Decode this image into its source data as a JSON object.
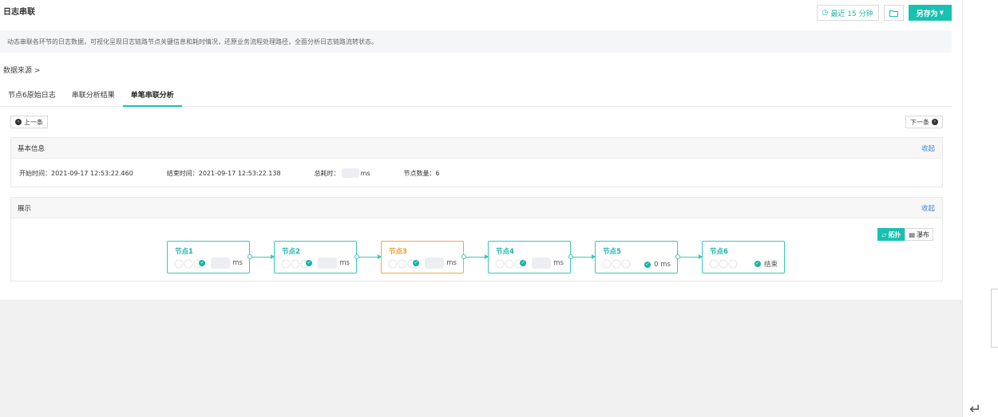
{
  "header": {
    "title": "日志串联",
    "time_range": "最近 15 分钟",
    "save_as": "另存为"
  },
  "description": "动态串联各环节的日志数据，可视化呈现日志链路节点关键信息和耗时情况，还原业务流程处理路径，全面分析日志链路流转状态。",
  "data_source": "数据来源 >",
  "tabs": [
    {
      "label": "节点6原始日志"
    },
    {
      "label": "串联分析结果"
    },
    {
      "label": "单笔串联分析"
    }
  ],
  "nav": {
    "prev": "上一条",
    "next": "下一条"
  },
  "basic_info": {
    "title": "基本信息",
    "collapse": "收起",
    "start_label": "开始时间：",
    "start_value": "2021-09-17 12:53:22.460",
    "end_label": "结束时间：",
    "end_value": "2021-09-17 12:53:22.138",
    "total_label": "总耗时：",
    "total_unit": "ms",
    "count_label": "节点数量：",
    "count_value": "6"
  },
  "display": {
    "title": "展示",
    "collapse": "收起",
    "view_topology": "拓扑",
    "view_waterfall": "瀑布",
    "nodes": [
      {
        "name": "节点1",
        "unit": "ms"
      },
      {
        "name": "节点2",
        "unit": "ms"
      },
      {
        "name": "节点3",
        "unit": "ms"
      },
      {
        "name": "节点4",
        "unit": "ms"
      },
      {
        "name": "节点5",
        "unit": "0 ms"
      },
      {
        "name": "节点6",
        "unit": "结束"
      }
    ]
  },
  "colors": {
    "accent": "#18c1b2",
    "link": "#3e87d3",
    "highlight": "#f0a842"
  }
}
